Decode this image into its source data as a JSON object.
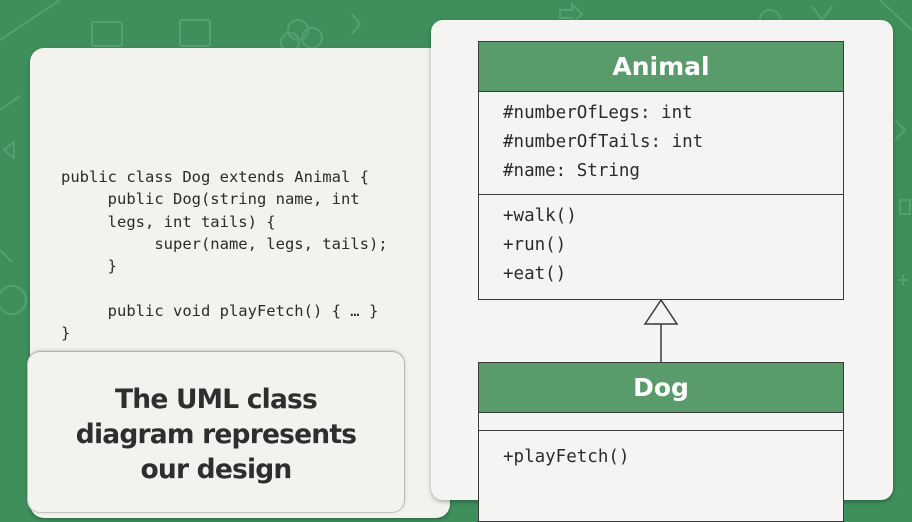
{
  "code_panel": {
    "code": "public class Dog extends Animal {\n     public Dog(string name, int\n     legs, int tails) {\n          super(name, legs, tails);\n     }\n\n     public void playFetch() { … }\n}"
  },
  "caption": {
    "lines": [
      "The UML class",
      "diagram represents",
      "our design"
    ]
  },
  "uml": {
    "parent": {
      "name": "Animal",
      "attributes": [
        "#numberOfLegs: int",
        "#numberOfTails: int",
        "#name: String"
      ],
      "operations": [
        "+walk()",
        "+run()",
        "+eat()"
      ]
    },
    "child": {
      "name": "Dog",
      "attributes": [],
      "operations": [
        "+playFetch()"
      ]
    }
  },
  "colors": {
    "background": "#3f8f5c",
    "class_header": "#5a9b6b",
    "card": "#f4f4f2"
  }
}
